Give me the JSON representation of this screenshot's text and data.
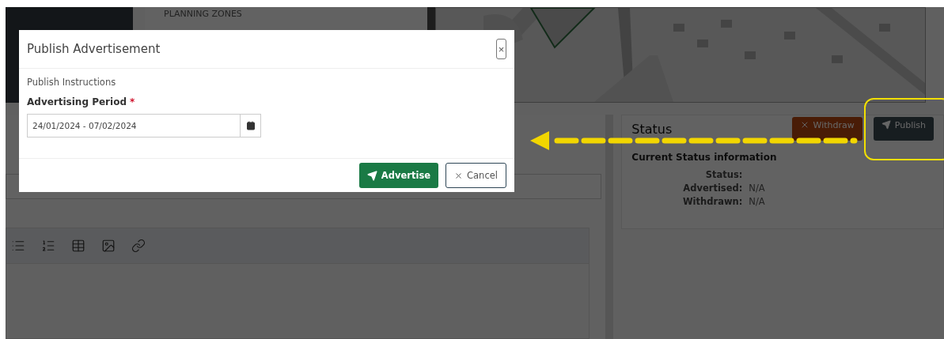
{
  "zones_card": {
    "heading": "PLANNING ZONES"
  },
  "status_card": {
    "title": "Status",
    "buttons": [
      {
        "label": "Withdraw",
        "kind": "withdraw"
      },
      {
        "label": "Publish",
        "kind": "publish"
      }
    ],
    "section_title": "Current Status information",
    "rows": [
      {
        "label": "Status:"
      },
      {
        "label": "Advertised:",
        "value": "N/A"
      },
      {
        "label": "Withdrawn:",
        "value": "N/A"
      }
    ]
  },
  "modal": {
    "title": "Publish Advertisement",
    "close": "×",
    "instructions": "Publish Instructions",
    "field": {
      "label": "Advertising Period",
      "required_mark": "*",
      "value": "24/01/2024 - 07/02/2024"
    },
    "buttons": [
      {
        "label": "Advertise",
        "kind": "primary"
      },
      {
        "label": "Cancel",
        "kind": "secondary"
      }
    ]
  }
}
